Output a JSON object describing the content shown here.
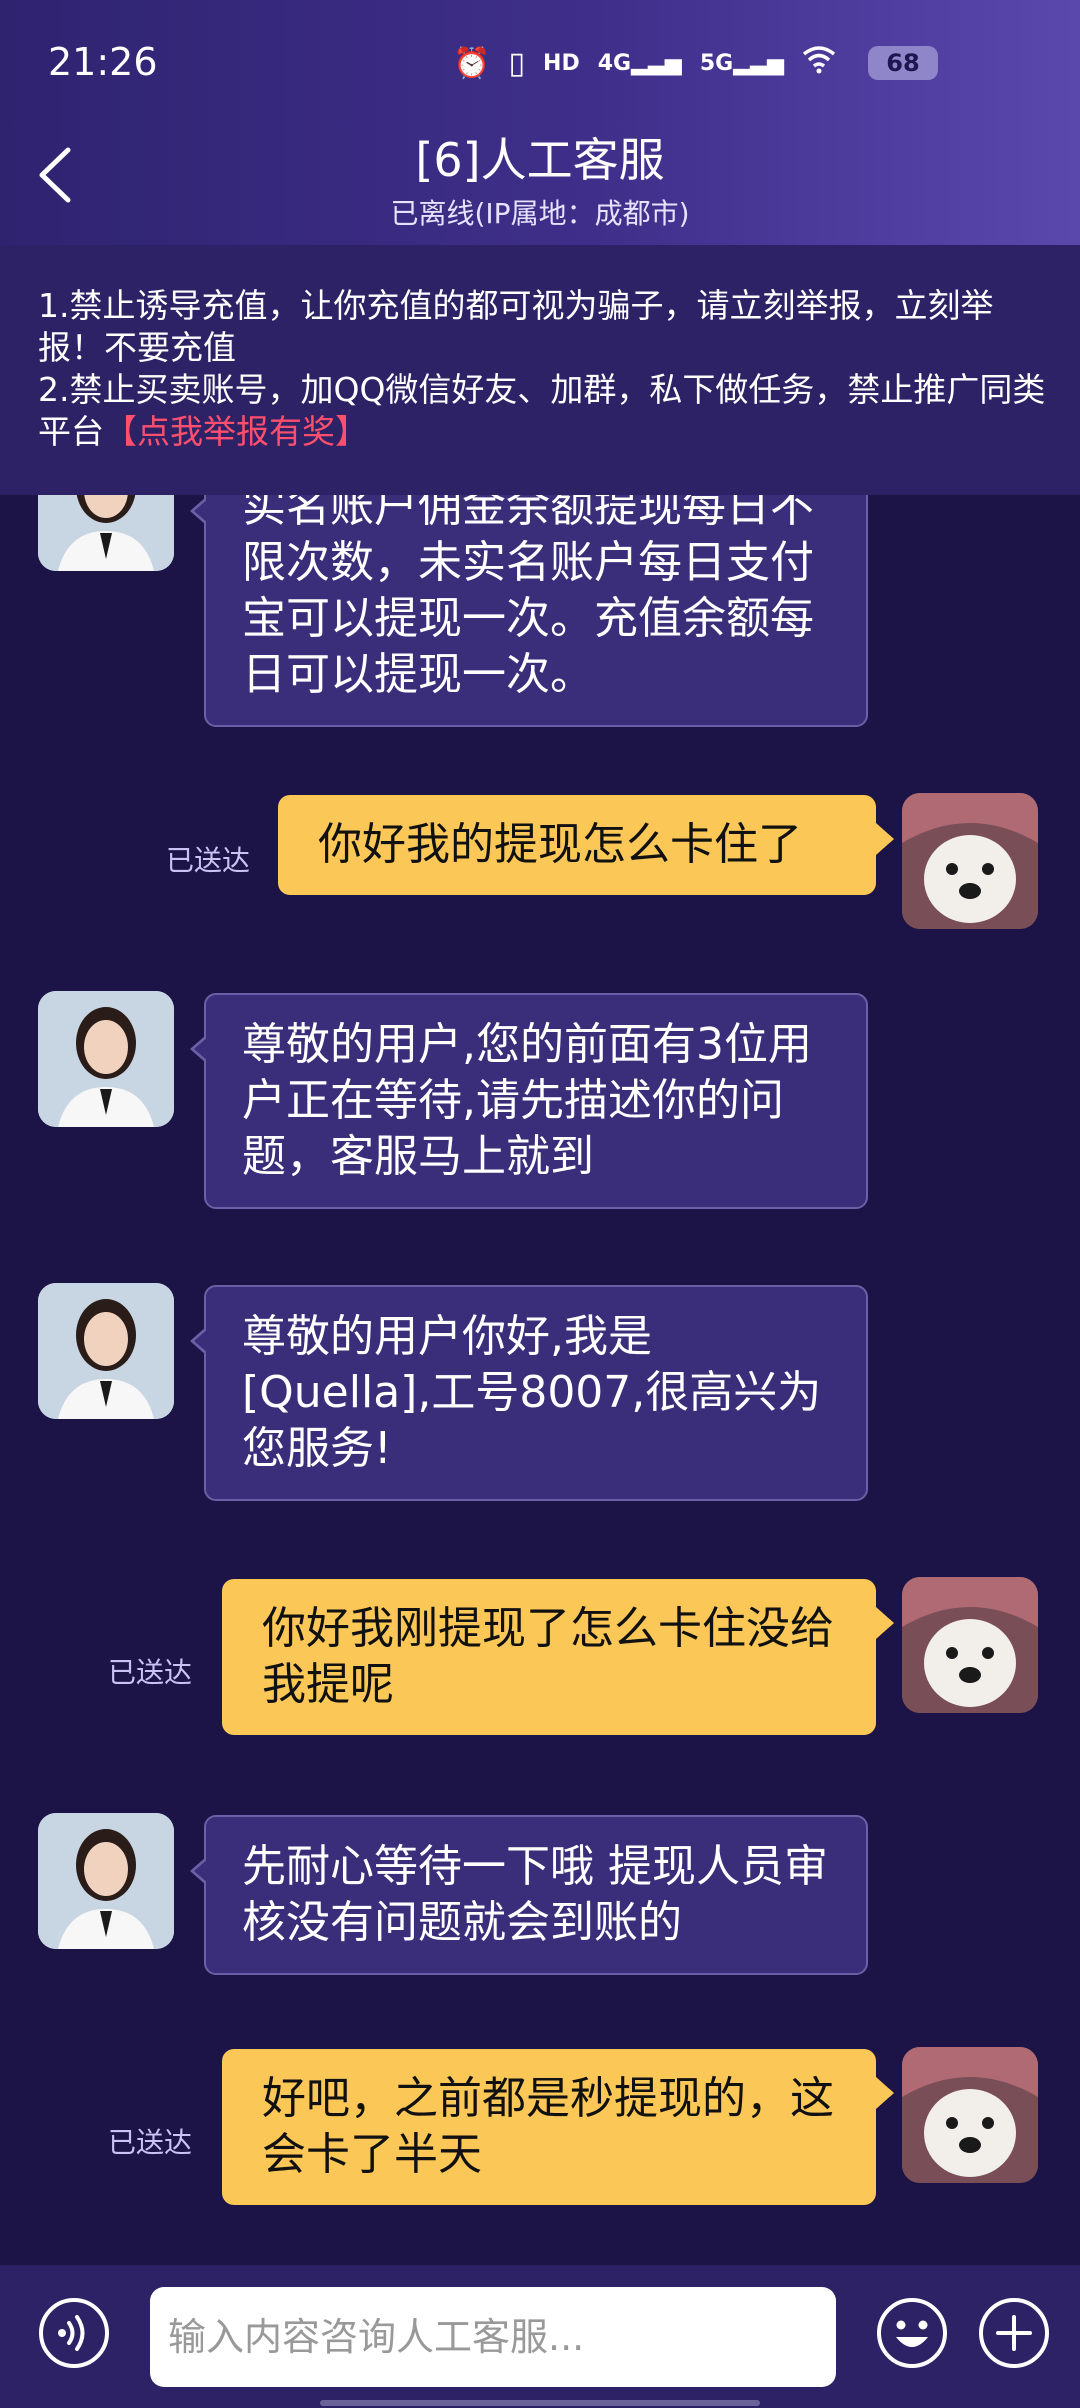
{
  "statusbar": {
    "time": "21:26",
    "icons": [
      "alarm-icon",
      "vibrate-icon",
      "hd-icon",
      "4g-signal-icon",
      "5g-signal-icon",
      "wifi-icon"
    ],
    "hd_label": "HD",
    "net1": "4G",
    "net2": "5G",
    "battery": "68"
  },
  "header": {
    "title": "[6]人工客服",
    "subtitle": "已离线(IP属地：成都市)"
  },
  "notice": {
    "line1": "1.禁止诱导充值，让你充值的都可视为骗子，请立刻举报，立刻举报！不要充值",
    "line2": "2.禁止买卖账号，加QQ微信好友、加群，私下做任务，禁止推广同类平台",
    "report_link": "【点我举报有奖】"
  },
  "chat": {
    "messages": [
      {
        "from": "agent",
        "text": "实名账户佣金余额提现每日不限次数，未实名账户每日支付宝可以提现一次。充值余额每日可以提现一次。"
      },
      {
        "from": "user",
        "text": "你好我的提现怎么卡住了",
        "status": "已送达"
      },
      {
        "from": "agent",
        "text": "尊敬的用户,您的前面有3位用户正在等待,请先描述你的问题，客服马上就到"
      },
      {
        "from": "agent",
        "text": "尊敬的用户你好,我是[Quella],工号8007,很高兴为您服务!"
      },
      {
        "from": "user",
        "text": "你好我刚提现了怎么卡住没给我提呢",
        "status": "已送达"
      },
      {
        "from": "agent",
        "text": "先耐心等待一下哦 提现人员审核没有问题就会到账的"
      },
      {
        "from": "user",
        "text": "好吧，之前都是秒提现的，这会卡了半天",
        "status": "已送达"
      }
    ]
  },
  "input": {
    "placeholder": "输入内容咨询人工客服..."
  },
  "colors": {
    "background": "#1c1447",
    "agent_bubble": "#3a2d7a",
    "user_bubble": "#fbc857",
    "report_link": "#ff4f6e"
  }
}
